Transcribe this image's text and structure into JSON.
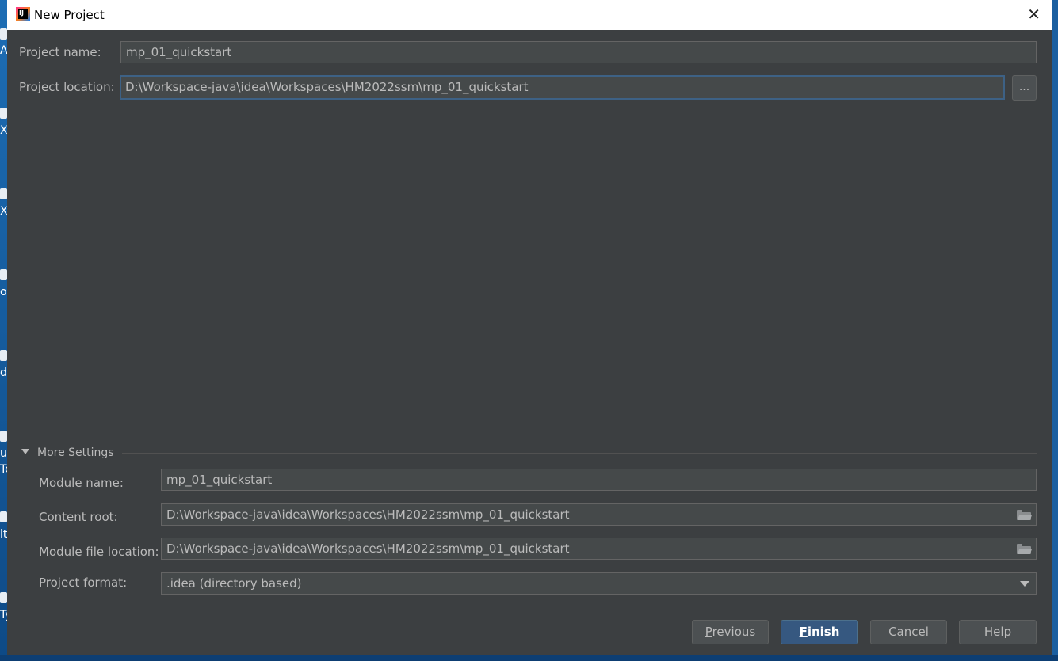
{
  "window": {
    "title": "New Project",
    "close_glyph": "✕"
  },
  "project": {
    "name_label": "Project name:",
    "name_value": "mp_01_quickstart",
    "location_label": "Project location:",
    "location_value": "D:\\Workspace-java\\idea\\Workspaces\\HM2022ssm\\mp_01_quickstart",
    "browse_label": "..."
  },
  "more_settings": {
    "toggle_label": "More Settings",
    "module_name_label": "Module name:",
    "module_name_value": "mp_01_quickstart",
    "content_root_label": "Content root:",
    "content_root_value": "D:\\Workspace-java\\idea\\Workspaces\\HM2022ssm\\mp_01_quickstart",
    "module_file_label": "Module file location:",
    "module_file_value": "D:\\Workspace-java\\idea\\Workspaces\\HM2022ssm\\mp_01_quickstart",
    "format_label": "Project format:",
    "format_value": ".idea (directory based)"
  },
  "buttons": {
    "previous_mnemonic": "P",
    "previous_rest": "revious",
    "finish_mnemonic": "F",
    "finish_rest": "inish",
    "cancel": "Cancel",
    "help": "Help"
  },
  "desktop_fragments": [
    "Al",
    "Xs",
    "X",
    "o",
    "di",
    "u",
    "Tc",
    "lt",
    "Ty"
  ],
  "colors": {
    "dialog_bg": "#3c3f41",
    "field_bg": "#45494a",
    "focus_border": "#3d6185",
    "primary_button": "#365880",
    "text": "#bbbbbb"
  }
}
